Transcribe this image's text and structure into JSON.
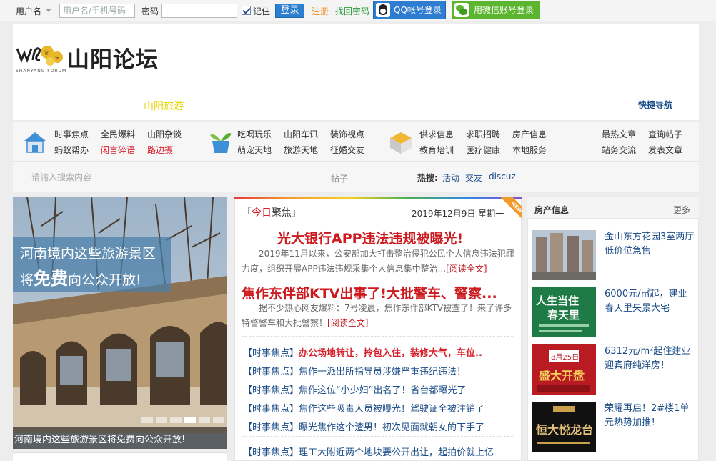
{
  "login": {
    "username_label": "用户名",
    "username_placeholder": "用户名/手机号码",
    "password_label": "密码",
    "remember_label": "记住",
    "login_button": "登录",
    "register_link": "注册",
    "recover_link": "找回密码",
    "qq_button": "QQ帐号登录",
    "wechat_button": "用微信账号登录"
  },
  "header": {
    "site_name": "山阳论坛",
    "logo_subtitle": "SHANYANG FORUM",
    "tour_link": "山阳旅游",
    "quick_nav": "快捷导航"
  },
  "nav": {
    "group1": [
      "时事焦点",
      "全民爆料",
      "山阳杂谈",
      "蚂蚁帮办",
      "闲言碎语",
      "路边摄"
    ],
    "group2": [
      "吃喝玩乐",
      "山阳车讯",
      "装饰视点",
      "萌宠天地",
      "旅游天地",
      "征婚交友"
    ],
    "group3": [
      "供求信息",
      "求职招聘",
      "房产信息",
      "教育培训",
      "医疗健康",
      "本地服务"
    ],
    "group4": [
      "最热文章",
      "查询帖子",
      "站务交流",
      "发表文章"
    ]
  },
  "search": {
    "placeholder": "请输入搜索内容",
    "type": "帖子",
    "hot_label": "热搜:",
    "hot_words": [
      "活动",
      "交友",
      "discuz"
    ]
  },
  "banner": {
    "caption_line1": "河南境内这些旅游景区",
    "caption_line2_pre": "将",
    "caption_line2_big": "免费",
    "caption_line2_post": "向公众开放!",
    "bottom_caption": "河南境内这些旅游景区将免费向公众开放!"
  },
  "news": {
    "tag_pre": "「",
    "tag_hl": "今日",
    "tag_main": "聚焦",
    "tag_post": "」",
    "ribbon": "NEW",
    "date": "2019年12月9日  星期一",
    "headline1": "光大银行APP违法违规被曝光!",
    "summary1": "2019年11月以来，公安部加大打击整治侵犯公民个人信息违法犯罪力度，组织开展APP违法违规采集个人信息集中整治...",
    "headline2": "焦作东伴部KTV出事了!大批警车、警察...",
    "summary2": "据不少热心网友爆料：7号凌晨，焦作东伴部KTV被查了！来了许多特警警车和大批警察！",
    "read_more": "[阅读全文]",
    "rows": [
      {
        "cat": "【时事焦点】",
        "title": "办公场地转让，拎包入住，装修大气，车位..",
        "red": true
      },
      {
        "cat": "【时事焦点】",
        "title": "焦作一派出所指导员涉嫌严重违纪违法！",
        "red": false
      },
      {
        "cat": "【时事焦点】",
        "title": "焦作这位“小少妇”出名了！省台都曝光了",
        "red": false
      },
      {
        "cat": "【时事焦点】",
        "title": "焦作这些吸毒人员被曝光！驾驶证全被注销了",
        "red": false
      },
      {
        "cat": "【时事焦点】",
        "title": "曝光焦作这个渣男！初次见面就朝女的下手了",
        "red": false
      },
      {
        "cat": "【时事焦点】",
        "title": "理工大附近两个地块要公开出让，起拍价就上亿",
        "red": false
      }
    ]
  },
  "property": {
    "title": "房产信息",
    "more": "更多",
    "items": [
      {
        "text": "金山东方花园3室两厅低价位急售"
      },
      {
        "text": "6000元/㎡起，建业春天里央景大宅",
        "thumb_line1": "人生当住",
        "thumb_line2": "春天里"
      },
      {
        "text": "6312元/m²起住建业迎宾府纯洋房！",
        "thumb_line1": "8月25日",
        "thumb_line2": "盛大开盘"
      },
      {
        "text": "荣耀再启！2#楼1单元热势加推！",
        "thumb_line1": "恒大悦龙台"
      }
    ]
  }
}
